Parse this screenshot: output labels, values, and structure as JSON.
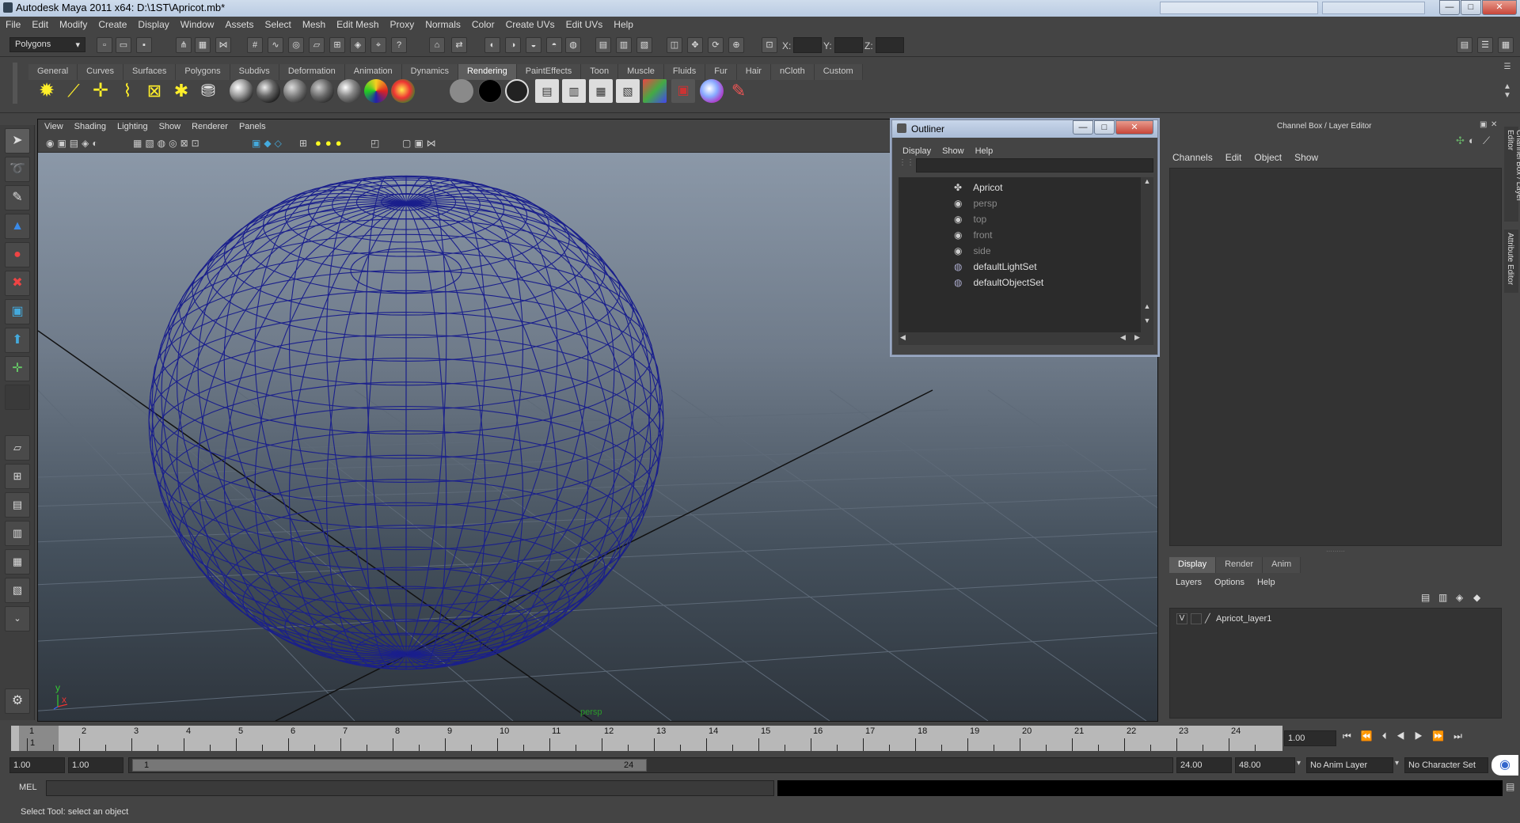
{
  "window": {
    "title": "Autodesk Maya 2011 x64: D:\\1ST\\Apricot.mb*",
    "min": "—",
    "max": "□",
    "close": "✕"
  },
  "menubar": [
    "File",
    "Edit",
    "Modify",
    "Create",
    "Display",
    "Window",
    "Assets",
    "Select",
    "Mesh",
    "Edit Mesh",
    "Proxy",
    "Normals",
    "Color",
    "Create UVs",
    "Edit UVs",
    "Help"
  ],
  "statusline": {
    "mode": "Polygons",
    "x_label": "X:",
    "y_label": "Y:",
    "z_label": "Z:"
  },
  "shelf": {
    "tabs": [
      "General",
      "Curves",
      "Surfaces",
      "Polygons",
      "Subdivs",
      "Deformation",
      "Animation",
      "Dynamics",
      "Rendering",
      "PaintEffects",
      "Toon",
      "Muscle",
      "Fluids",
      "Fur",
      "Hair",
      "nCloth",
      "Custom"
    ],
    "active_tab": "Rendering"
  },
  "viewport": {
    "menu": [
      "View",
      "Shading",
      "Lighting",
      "Show",
      "Renderer",
      "Panels"
    ],
    "camera_label": "persp",
    "axis_y": "y",
    "axis_x": "x",
    "wire_color": "#1a1f8c"
  },
  "outliner": {
    "title": "Outliner",
    "menu": [
      "Display",
      "Show",
      "Help"
    ],
    "items": [
      {
        "label": "Apricot",
        "dim": false
      },
      {
        "label": "persp",
        "dim": true
      },
      {
        "label": "top",
        "dim": true
      },
      {
        "label": "front",
        "dim": true
      },
      {
        "label": "side",
        "dim": true
      },
      {
        "label": "defaultLightSet",
        "dim": false
      },
      {
        "label": "defaultObjectSet",
        "dim": false
      }
    ]
  },
  "channelbox": {
    "title": "Channel Box / Layer Editor",
    "menu": [
      "Channels",
      "Edit",
      "Object",
      "Show"
    ],
    "side_tab_1": "Channel Box / Layer Editor",
    "side_tab_2": "Attribute Editor",
    "layer_tabs": [
      "Display",
      "Render",
      "Anim"
    ],
    "layer_menu": [
      "Layers",
      "Options",
      "Help"
    ],
    "layer": {
      "visible": "V",
      "name": "Apricot_layer1"
    }
  },
  "timeline": {
    "ticks": [
      "1",
      "2",
      "3",
      "4",
      "5",
      "6",
      "7",
      "8",
      "9",
      "10",
      "11",
      "12",
      "13",
      "14",
      "15",
      "16",
      "17",
      "18",
      "19",
      "20",
      "21",
      "22",
      "23",
      "24"
    ],
    "current_frame": "1",
    "current_field": "1.00"
  },
  "range": {
    "start": "1.00",
    "start2": "1.00",
    "slider_start": "1",
    "slider_end": "24",
    "end": "24.00",
    "end2": "48.00",
    "anim_layer": "No Anim Layer",
    "char_set": "No Character Set"
  },
  "cmdline": {
    "label": "MEL"
  },
  "helpline": {
    "text": "Select Tool: select an object"
  }
}
